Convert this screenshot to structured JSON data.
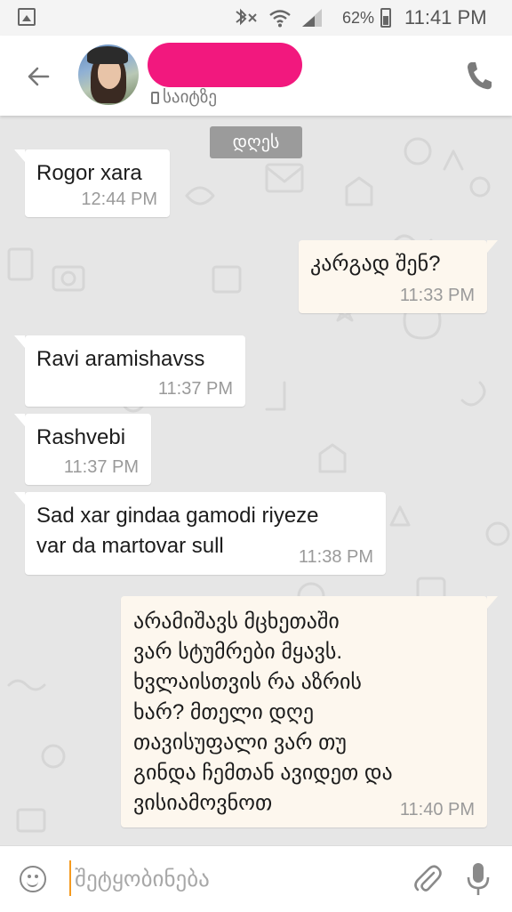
{
  "status_bar": {
    "battery_percent": "62%",
    "time": "11:41 PM",
    "icons": [
      "gallery-icon",
      "bluetooth-mute-icon",
      "wifi-icon",
      "signal-icon",
      "battery-icon"
    ]
  },
  "header": {
    "contact_status": "საიტზე",
    "icons": [
      "back-arrow-icon",
      "phone-call-icon"
    ]
  },
  "chat": {
    "date_label": "დღეს",
    "messages": [
      {
        "direction": "incoming",
        "text": "Rogor xara",
        "time": "12:44 PM"
      },
      {
        "direction": "outgoing",
        "text": "კარგად შენ?",
        "time": "11:33 PM"
      },
      {
        "direction": "incoming",
        "text": "Ravi aramishavss",
        "time": "11:37 PM"
      },
      {
        "direction": "incoming",
        "text": "Rashvebi",
        "time": "11:37 PM"
      },
      {
        "direction": "incoming",
        "text": "Sad xar gindaa gamodi riyeze\nvar da martovar sull",
        "time": "11:38 PM"
      },
      {
        "direction": "outgoing",
        "text": "არამიშავს მცხეთაში\nვარ სტუმრები მყავს.\nხვლაისთვის რა აზრის\nხარ? მთელი დღე\nთავისუფალი ვარ თუ\nგინდა ჩემთან ავიდეთ და\nვისიამოვნოთ",
        "time": "11:40 PM"
      }
    ]
  },
  "input_bar": {
    "placeholder": "შეტყობინება",
    "icons": [
      "emoji-icon",
      "attach-icon",
      "microphone-icon"
    ]
  },
  "colors": {
    "chat_background": "#e6e6e6",
    "incoming_bubble": "#ffffff",
    "outgoing_bubble": "#fdf7ee",
    "date_chip": "#9b9b9b",
    "name_redaction": "#f2187e",
    "input_cursor": "#f59a1f"
  }
}
